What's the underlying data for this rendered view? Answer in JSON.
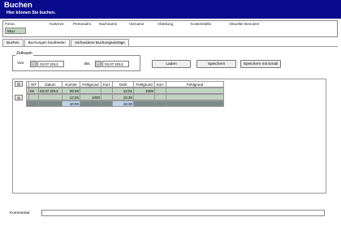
{
  "header": {
    "title": "Buchen",
    "subtitle": "Hier können Sie buchen."
  },
  "info": {
    "labels": [
      "Firma",
      "Kartennr.",
      "Personalnr.",
      "Nachname",
      "Vorname",
      "Abteilung",
      "Kostenstelle",
      "Aktueller Benutzer"
    ],
    "firma_value": "MLU"
  },
  "tabs": [
    "Buchen",
    "Buchungen bearbeiten",
    "Vorhandene Buchungsanträge"
  ],
  "active_tab": "Buchungen bearbeiten",
  "zeitraum": {
    "legend": "Zeitraum",
    "von_label": "Von",
    "bis_label": "Bis",
    "von_btn": "...",
    "bis_btn": "...",
    "von_date": "03.07.2013",
    "bis_date": "03.07.2013"
  },
  "buttons": {
    "laden": "Laden",
    "speichern": "Speichern",
    "speichern_email": "Speichern mit Email"
  },
  "side_icons": [
    "grid-add-icon",
    "grid-delete-icon"
  ],
  "table": {
    "headers": [
      "",
      "WT",
      "Datum",
      "Kommt",
      "Fehlgrund",
      "Korr.",
      "Geht",
      "Fehlgrund",
      "Korr.",
      "Fehlgrund"
    ],
    "rows": [
      [
        "",
        "Mi",
        "03.07.2013",
        "08:48",
        "",
        "",
        "12:01",
        "1000",
        "",
        ""
      ],
      [
        "",
        "",
        "",
        "12:26",
        "1000",
        "",
        "15:30",
        "",
        "",
        ""
      ],
      [
        "",
        "",
        "",
        "10:00",
        "",
        "",
        "16:30",
        "",
        "",
        ""
      ]
    ]
  },
  "kommentar": {
    "label": "Kommentar",
    "value": ""
  },
  "colors": {
    "header_bg": "#0a0a8c",
    "cell_green": "#c2d3c2",
    "summary_gray": "#7d8b8a",
    "summary_blue": "#bfd2ea"
  }
}
